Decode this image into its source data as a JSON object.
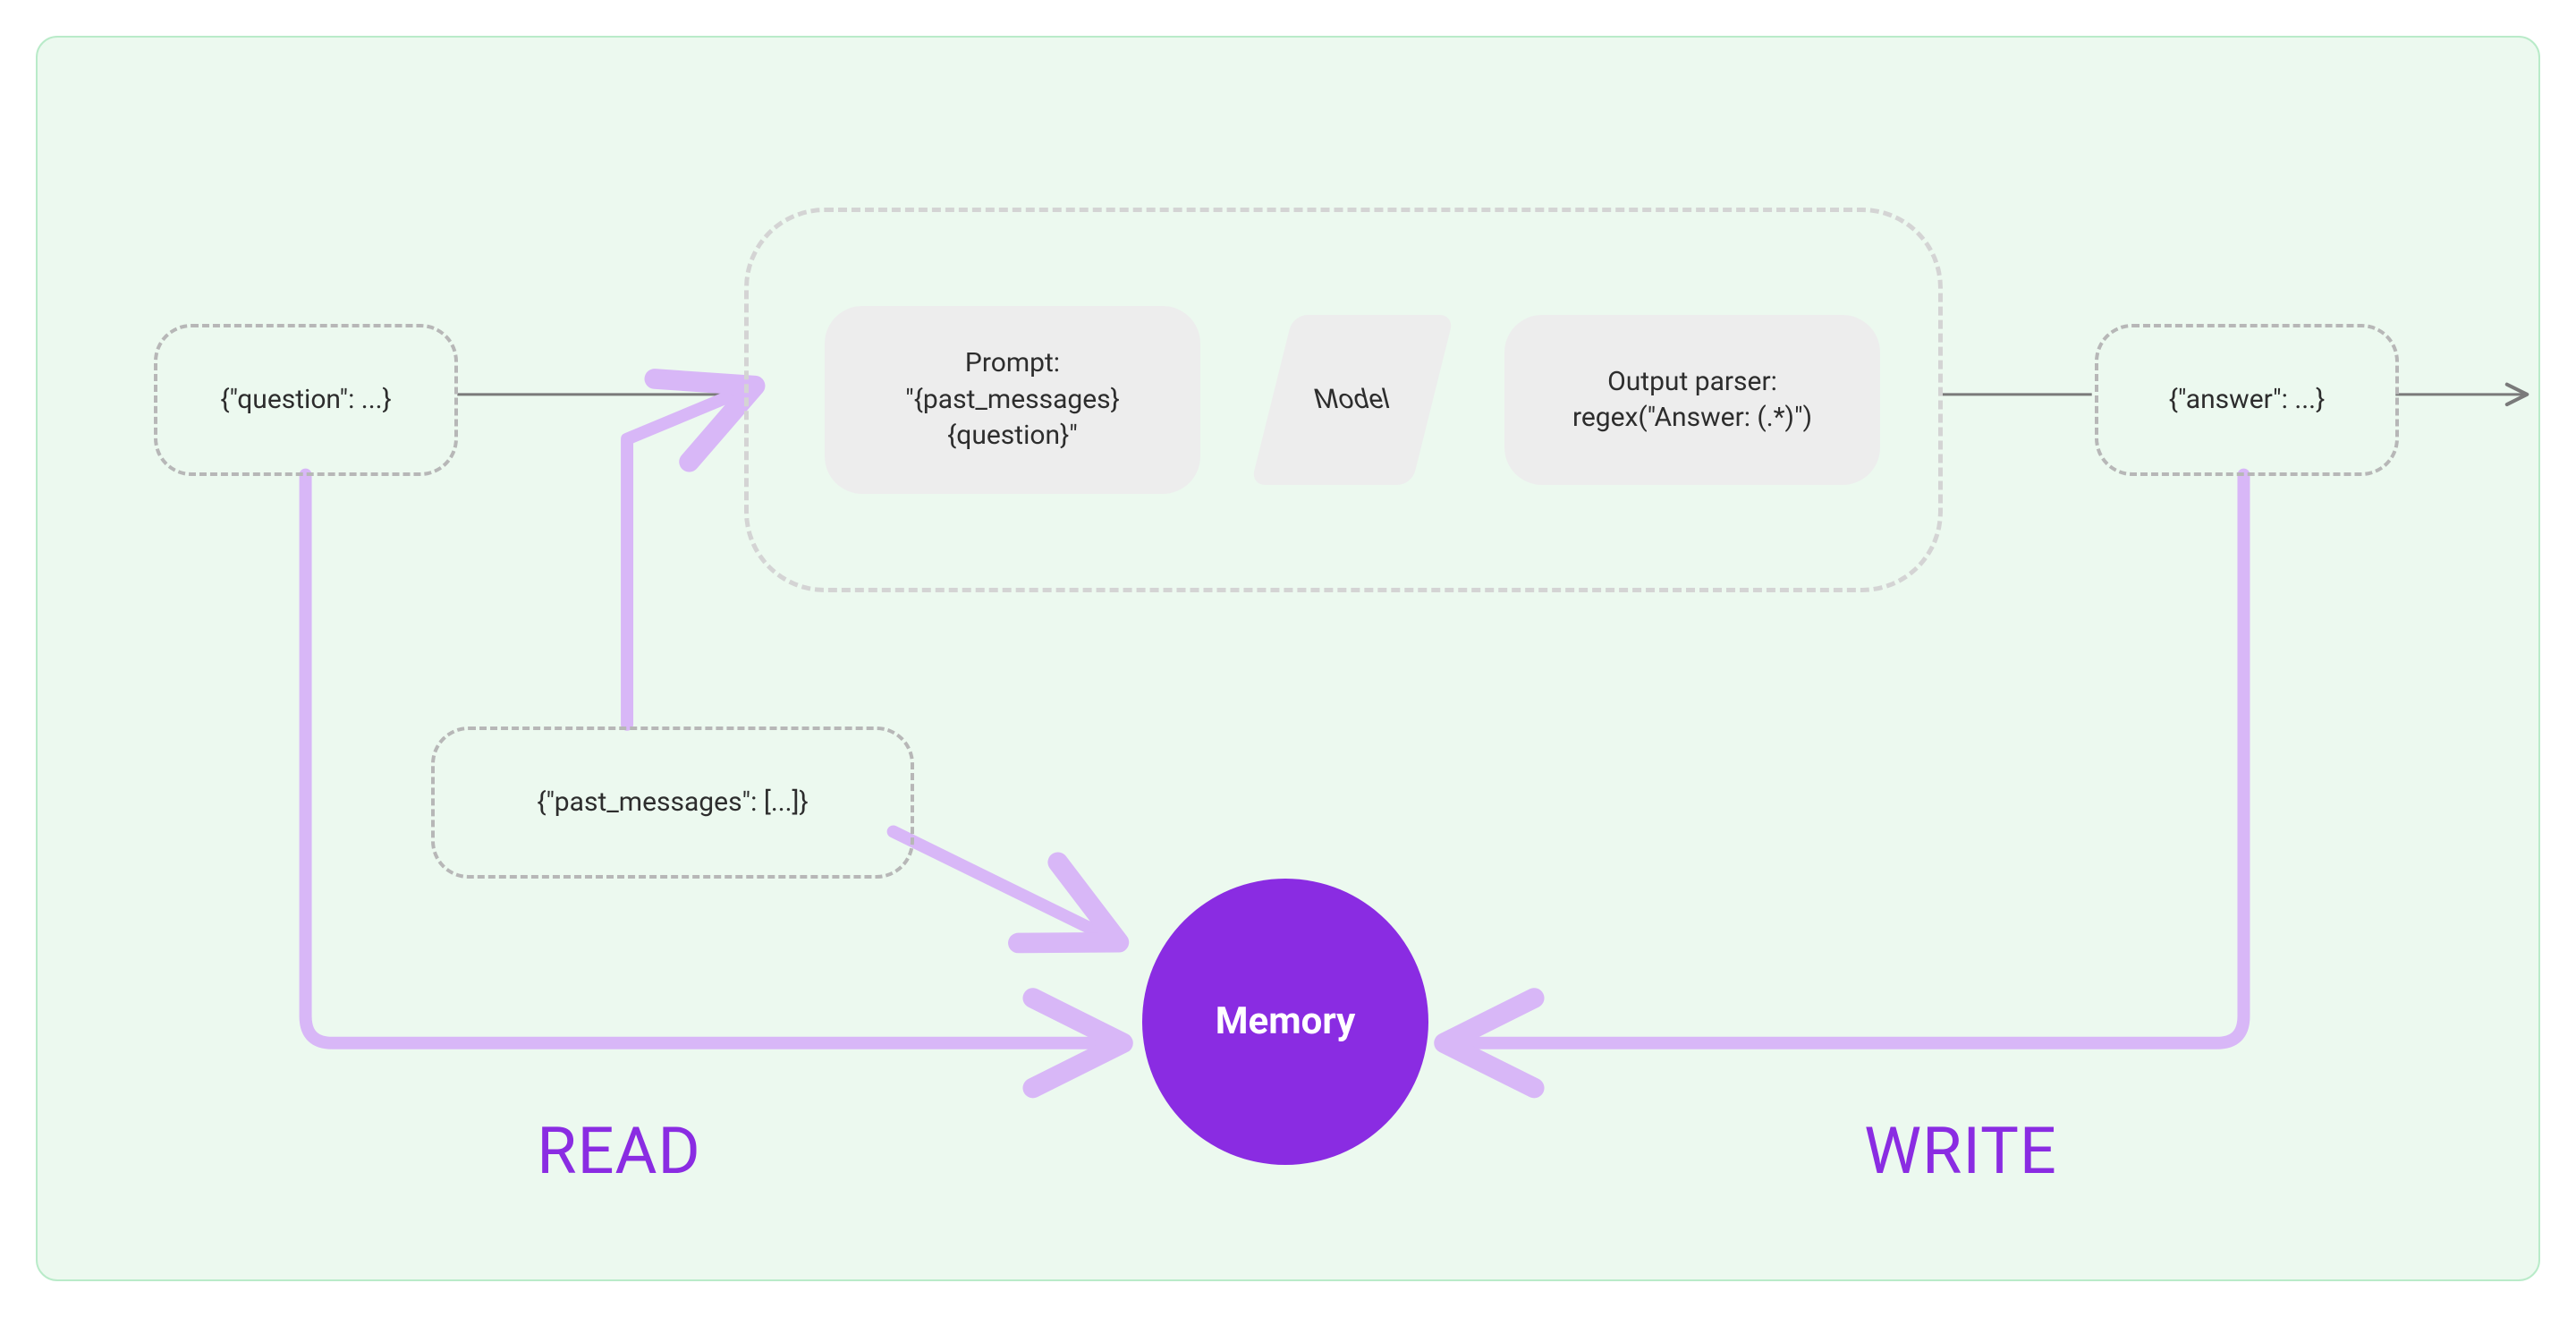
{
  "nodes": {
    "question": "{\"question\": ...}",
    "answer": "{\"answer\": ...}",
    "past_messages": "{\"past_messages\": [...]}",
    "prompt_line1": "Prompt:",
    "prompt_line2": "\"{past_messages}",
    "prompt_line3": "{question}\"",
    "model": "Model",
    "parser_line1": "Output parser:",
    "parser_line2": "regex(\"Answer: (.*)\")",
    "memory": "Memory"
  },
  "labels": {
    "read": "READ",
    "write": "WRITE"
  },
  "colors": {
    "accent": "#8a2ce2",
    "accent_light": "#d8b7f7",
    "box_dash": "#b7b7b7",
    "box_fill": "#ededed",
    "arrow_gray": "#7a7a7a",
    "bg": "#ecf9ef",
    "border": "#b9ebc9"
  }
}
